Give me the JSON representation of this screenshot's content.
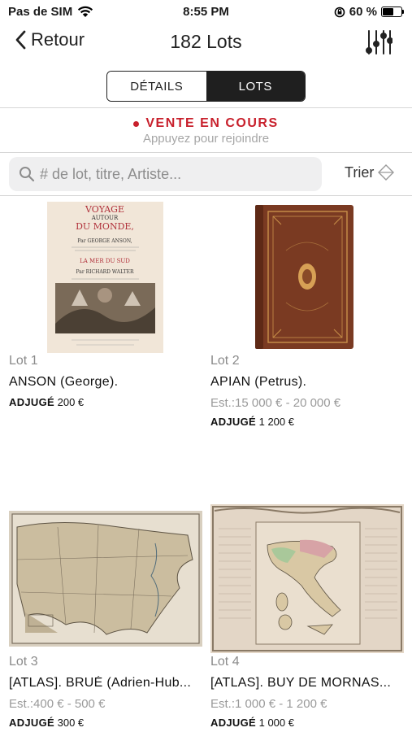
{
  "status_bar": {
    "carrier": "Pas de SIM",
    "time": "8:55 PM",
    "battery": "60 %",
    "battery_level": 0.6
  },
  "nav": {
    "back_label": "Retour",
    "title": "182 Lots"
  },
  "tabs": [
    {
      "label": "DÉTAILS",
      "active": false
    },
    {
      "label": "LOTS",
      "active": true
    }
  ],
  "live_banner": {
    "title": "VENTE EN COURS",
    "subtitle": "Appuyez pour rejoindre"
  },
  "search": {
    "placeholder": "# de lot, titre, Artiste...",
    "value": ""
  },
  "sort": {
    "label": "Trier"
  },
  "lots": [
    {
      "number": "Lot 1",
      "title": "ANSON (George).",
      "estimate": "",
      "result_label": "ADJUGÉ",
      "result_value": "200 €",
      "image_icon": "book-title-page",
      "image_text": [
        "VOYAGE",
        "AUTOUR",
        "DU MONDE,",
        "Par GEORGE ANSON,",
        "LA MER DU SUD",
        "Par RICHARD WALTER"
      ]
    },
    {
      "number": "Lot 2",
      "title": "APIAN (Petrus).",
      "estimate": "Est.:15 000 € - 20 000 €",
      "result_label": "ADJUGÉ",
      "result_value": "1 200 €",
      "image_icon": "leather-book"
    },
    {
      "number": "Lot 3",
      "title": "[ATLAS]. BRUÉ (Adrien-Hub...",
      "estimate": "Est.:400 € - 500 €",
      "result_label": "ADJUGÉ",
      "result_value": "300 €",
      "image_icon": "map-north-america"
    },
    {
      "number": "Lot 4",
      "title": "[ATLAS]. BUY DE MORNAS...",
      "estimate": "Est.:1 000 € - 1 200 €",
      "result_label": "ADJUGÉ",
      "result_value": "1 000 €",
      "image_icon": "map-italy"
    }
  ],
  "colors": {
    "accent_red": "#c8202c",
    "segment_dark": "#1f1f1f",
    "muted_text": "#8b8b8b"
  }
}
